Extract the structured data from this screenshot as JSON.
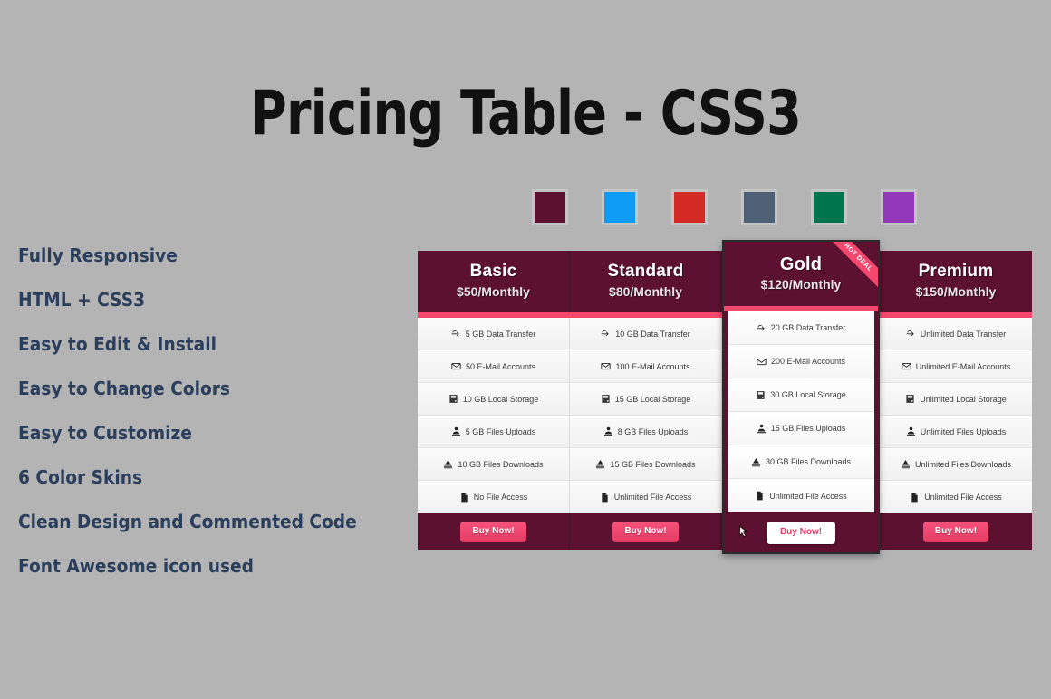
{
  "page": {
    "title": "Pricing Table - CSS3",
    "background_color": "#b4b4b4"
  },
  "features": {
    "items": [
      {
        "label": "Fully Responsive"
      },
      {
        "label": "HTML + CSS3"
      },
      {
        "label": "Easy to Edit & Install"
      },
      {
        "label": "Easy to Change Colors"
      },
      {
        "label": "Easy to Customize"
      },
      {
        "label": "6 Color Skins"
      },
      {
        "label": "Clean Design and Commented Code"
      },
      {
        "label": "Font Awesome icon used"
      }
    ],
    "text_color": "#2b3f5c"
  },
  "swatches": [
    {
      "name": "maroon-skin",
      "color": "#5c1130"
    },
    {
      "name": "blue-skin",
      "color": "#0d9bf5"
    },
    {
      "name": "red-skin",
      "color": "#d32a26"
    },
    {
      "name": "slate-skin",
      "color": "#4d6075"
    },
    {
      "name": "green-skin",
      "color": "#00744d"
    },
    {
      "name": "purple-skin",
      "color": "#9139b8"
    }
  ],
  "pricing_table": {
    "accent_color": "#f5486e",
    "header_color": "#5c1130",
    "ribbon_label": "HOT DEAL",
    "buy_label": "Buy Now!",
    "plans": [
      {
        "name": "Basic",
        "price": "$50/Monthly",
        "featured": false,
        "features": [
          {
            "icon": "exchange-icon",
            "label": "5 GB Data Transfer"
          },
          {
            "icon": "envelope-icon",
            "label": "50 E-Mail Accounts"
          },
          {
            "icon": "hdd-icon",
            "label": "10 GB Local Storage"
          },
          {
            "icon": "upload-icon",
            "label": "5 GB Files Uploads"
          },
          {
            "icon": "download-icon",
            "label": "10 GB Files Downloads"
          },
          {
            "icon": "file-icon",
            "label": "No File Access"
          }
        ],
        "buy_label": "Buy Now!"
      },
      {
        "name": "Standard",
        "price": "$80/Monthly",
        "featured": false,
        "features": [
          {
            "icon": "exchange-icon",
            "label": "10 GB Data Transfer"
          },
          {
            "icon": "envelope-icon",
            "label": "100 E-Mail Accounts"
          },
          {
            "icon": "hdd-icon",
            "label": "15 GB Local Storage"
          },
          {
            "icon": "upload-icon",
            "label": "8 GB Files Uploads"
          },
          {
            "icon": "download-icon",
            "label": "15 GB Files Downloads"
          },
          {
            "icon": "file-icon",
            "label": "Unlimited File Access"
          }
        ],
        "buy_label": "Buy Now!"
      },
      {
        "name": "Gold",
        "price": "$120/Monthly",
        "featured": true,
        "ribbon": "HOT DEAL",
        "features": [
          {
            "icon": "exchange-icon",
            "label": "20 GB Data Transfer"
          },
          {
            "icon": "envelope-icon",
            "label": "200 E-Mail Accounts"
          },
          {
            "icon": "hdd-icon",
            "label": "30 GB Local Storage"
          },
          {
            "icon": "upload-icon",
            "label": "15 GB Files Uploads"
          },
          {
            "icon": "download-icon",
            "label": "30 GB Files Downloads"
          },
          {
            "icon": "file-icon",
            "label": "Unlimited File Access"
          }
        ],
        "buy_label": "Buy Now!"
      },
      {
        "name": "Premium",
        "price": "$150/Monthly",
        "featured": false,
        "features": [
          {
            "icon": "exchange-icon",
            "label": "Unlimited Data Transfer"
          },
          {
            "icon": "envelope-icon",
            "label": "Unlimited E-Mail Accounts"
          },
          {
            "icon": "hdd-icon",
            "label": "Unlimited Local Storage"
          },
          {
            "icon": "upload-icon",
            "label": "Unlimited Files Uploads"
          },
          {
            "icon": "download-icon",
            "label": "Unlimited Files Downloads"
          },
          {
            "icon": "file-icon",
            "label": "Unlimited File Access"
          }
        ],
        "buy_label": "Buy Now!"
      }
    ]
  }
}
